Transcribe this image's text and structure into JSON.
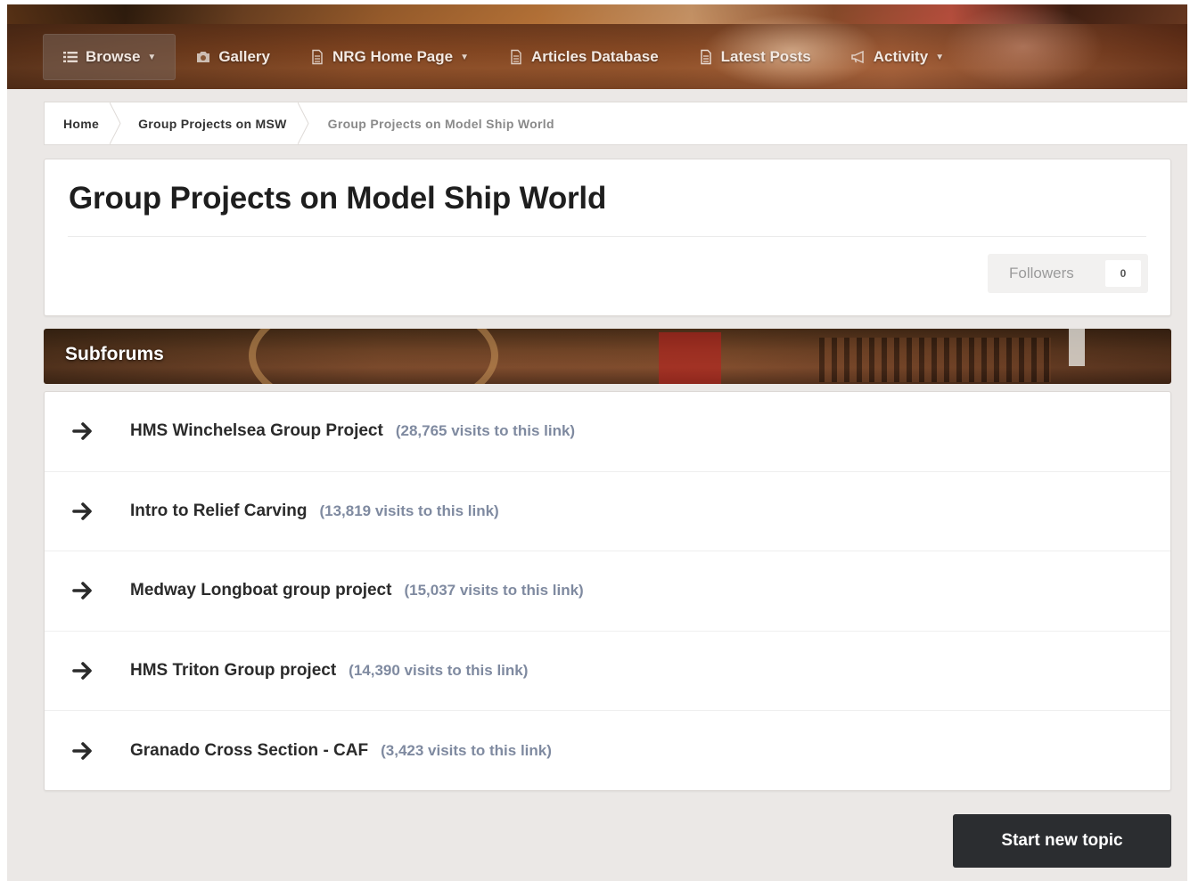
{
  "nav": {
    "items": [
      {
        "label": "Browse",
        "icon": "list-icon",
        "caret": true
      },
      {
        "label": "Gallery",
        "icon": "camera-icon",
        "caret": false
      },
      {
        "label": "NRG Home Page",
        "icon": "document-icon",
        "caret": true
      },
      {
        "label": "Articles Database",
        "icon": "document-icon",
        "caret": false
      },
      {
        "label": "Latest Posts",
        "icon": "document-icon",
        "caret": false
      },
      {
        "label": "Activity",
        "icon": "megaphone-icon",
        "caret": true
      }
    ]
  },
  "breadcrumb": [
    {
      "label": "Home"
    },
    {
      "label": "Group Projects on MSW"
    },
    {
      "label": "Group Projects on Model Ship World"
    }
  ],
  "page": {
    "title": "Group Projects on Model Ship World",
    "followers_label": "Followers",
    "followers_count": "0"
  },
  "subforums": {
    "title": "Subforums",
    "items": [
      {
        "name": "HMS Winchelsea Group Project",
        "visits": "(28,765 visits to this link)"
      },
      {
        "name": "Intro to Relief Carving",
        "visits": "(13,819 visits to this link)"
      },
      {
        "name": "Medway Longboat group project",
        "visits": "(15,037 visits to this link)"
      },
      {
        "name": "HMS Triton Group project",
        "visits": "(14,390 visits to this link)"
      },
      {
        "name": "Granado Cross Section - CAF",
        "visits": "(3,423 visits to this link)"
      }
    ]
  },
  "actions": {
    "start_topic_label": "Start new topic"
  },
  "colors": {
    "button_bg": "#2b2d30",
    "visits_text": "#7f8aa0",
    "page_bg": "#ebe8e6"
  }
}
